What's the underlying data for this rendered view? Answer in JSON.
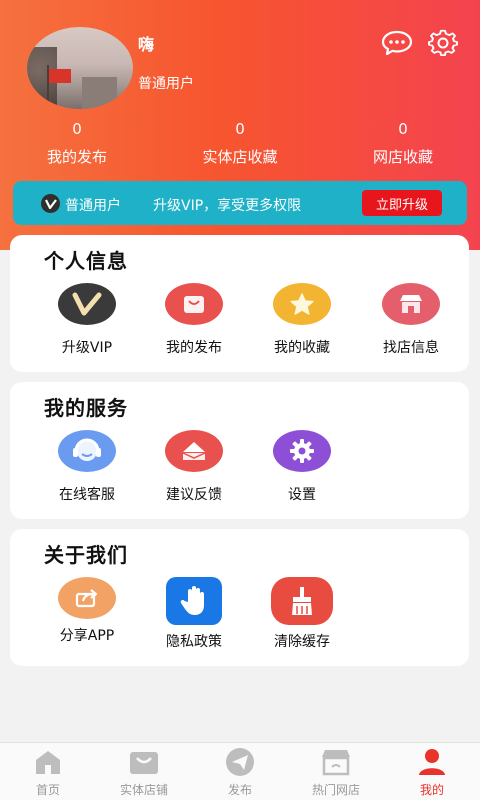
{
  "profile": {
    "nickname": "嗨",
    "role": "普通用户"
  },
  "header_icons": [
    "message-icon",
    "settings-gear-icon"
  ],
  "stats": [
    {
      "value": "0",
      "label": "我的发布"
    },
    {
      "value": "0",
      "label": "实体店收藏"
    },
    {
      "value": "0",
      "label": "网店收藏"
    }
  ],
  "vip_bar": {
    "role": "普通用户",
    "promo": "升级VIP，享受更多权限",
    "button": "立即升级"
  },
  "sections": [
    {
      "title": "个人信息",
      "items": [
        {
          "label": "升级VIP",
          "icon": "vip-icon"
        },
        {
          "label": "我的发布",
          "icon": "shopping-bag-icon"
        },
        {
          "label": "我的收藏",
          "icon": "star-icon"
        },
        {
          "label": "找店信息",
          "icon": "store-icon"
        }
      ]
    },
    {
      "title": "我的服务",
      "items": [
        {
          "label": "在线客服",
          "icon": "headset-icon"
        },
        {
          "label": "建议反馈",
          "icon": "mail-feedback-icon"
        },
        {
          "label": "设置",
          "icon": "gear-icon"
        }
      ]
    },
    {
      "title": "关于我们",
      "items": [
        {
          "label": "分享APP",
          "icon": "share-icon"
        },
        {
          "label": "隐私政策",
          "icon": "hand-icon"
        },
        {
          "label": "清除缓存",
          "icon": "broom-icon"
        }
      ]
    }
  ],
  "tabbar": [
    {
      "label": "首页",
      "icon": "home-icon",
      "active": false
    },
    {
      "label": "实体店铺",
      "icon": "shop-bag-icon",
      "active": false
    },
    {
      "label": "发布",
      "icon": "send-icon",
      "active": false
    },
    {
      "label": "热门网店",
      "icon": "online-store-icon",
      "active": false
    },
    {
      "label": "我的",
      "icon": "user-icon",
      "active": true
    }
  ],
  "colors": {
    "header_start": "#f5713f",
    "header_end": "#f4434f",
    "vip_bar": "#1fb1c8",
    "upgrade_button": "#e8151c",
    "active_tab": "#e8322a"
  }
}
